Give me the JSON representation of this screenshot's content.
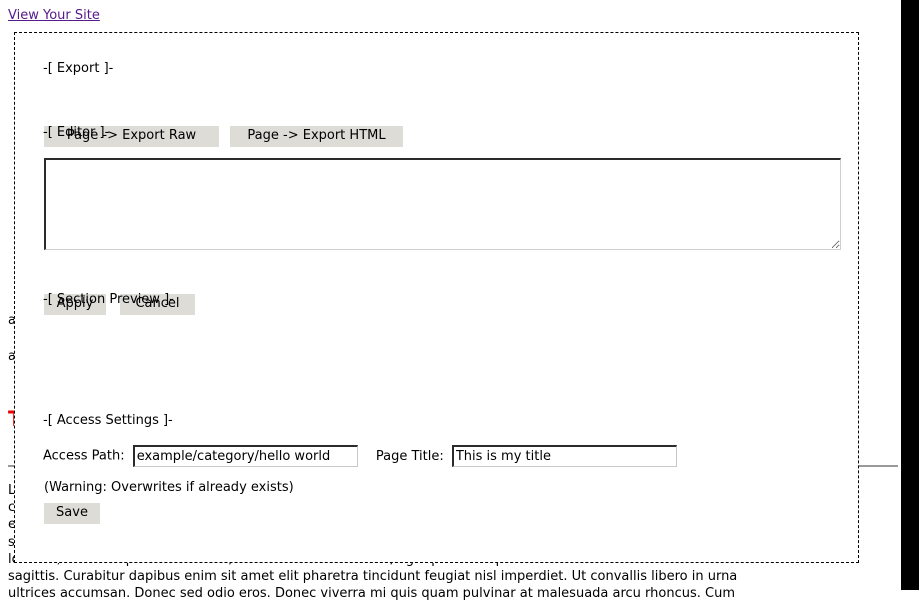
{
  "background": {
    "view_site_link": "View Your Site",
    "partial_line_1": "accumsan",
    "partial_line_2": "ante",
    "red_heading": "This is my title",
    "lorem_lines": [
      "Lorem ipsum dolor sit amet, consectetur adipiscing elit. Nullam tincidunt, nisi vel",
      "condimentum facilisis, arcu lorem venenatis nunc, sed dignissim libero nisl vitae",
      "est. Sed ut perspiciatis unde omnis iste natus error sit voluptatem accusantium",
      "sollicitudin. Praesent vel lacus nec justo vehicula tincidunt a non neque. Integer",
      "lobortis, mauris a pulvinar viverra, lectus nibh dictum arcu, eget pellentesque nunc"
    ],
    "visible_paragraph": "sagittis. Curabitur dapibus enim sit amet elit pharetra tincidunt feugiat nisl imperdiet. Ut convallis libero in urna",
    "clipped_paragraph": "ultrices accumsan. Donec sed odio eros. Donec viverra mi quis quam pulvinar at malesuada arcu rhoncus. Cum"
  },
  "panel": {
    "export_section_label": "-[ Export ]-",
    "editor_section_label": "-[ Editor ]-",
    "preview_section_label": "-[ Section Preview ]-",
    "access_section_label": "-[ Access Settings ]-",
    "export_raw_button": "Page -> Export Raw",
    "export_html_button": "Page -> Export HTML",
    "apply_button": "Apply",
    "cancel_button": "Cancel",
    "save_button": "Save",
    "editor_value": "",
    "editor_placeholder": "",
    "access_path_label": "Access Path:",
    "access_path_value": "example/category/hello world",
    "page_title_label": "Page Title:",
    "page_title_value": "This is my title",
    "warning_text": "(Warning: Overwrites if already exists)"
  },
  "colors": {
    "button_face": "#dddcd7",
    "link_visited": "#551a8b",
    "heading_red": "#ee0000",
    "panel_border": "#000000",
    "band": "#000000"
  }
}
